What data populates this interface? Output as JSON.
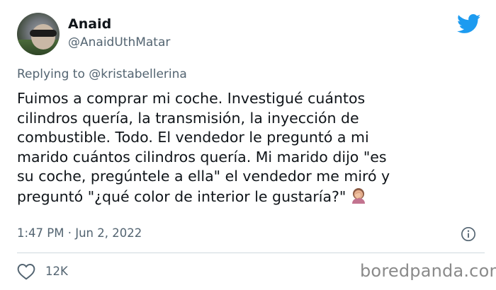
{
  "author": {
    "name": "Anaid",
    "handle": "@AnaidUthMatar",
    "avatar_icon": "profile-photo"
  },
  "platform_icon": "twitter-bird-icon",
  "reply_context": {
    "prefix": "Replying to",
    "mention": "@kristabellerina"
  },
  "tweet": {
    "lines": [
      "Fuimos a comprar mi coche. Investigué cuántos",
      "cilindros quería, la transmisión, la inyección de",
      "combustible. Todo. El vendedor le preguntó a mi",
      "marido cuántos cilindros quería. Mi marido dijo \"es",
      "su coche, pregúntele a ella\" el vendedor me miró y",
      "preguntó \"¿qué color de interior le gustaría?\""
    ],
    "emoji": "woman-facepalming"
  },
  "meta": {
    "timestamp": "1:47 PM · Jun 2, 2022",
    "info_icon": "info-icon"
  },
  "engagement": {
    "like_icon": "heart-icon",
    "likes": "12K"
  },
  "watermark": "boredpanda.com",
  "colors": {
    "primary_text": "#0f1419",
    "secondary_text": "#536471",
    "twitter_blue": "#1d9bf0",
    "divider": "#cfd9de"
  }
}
